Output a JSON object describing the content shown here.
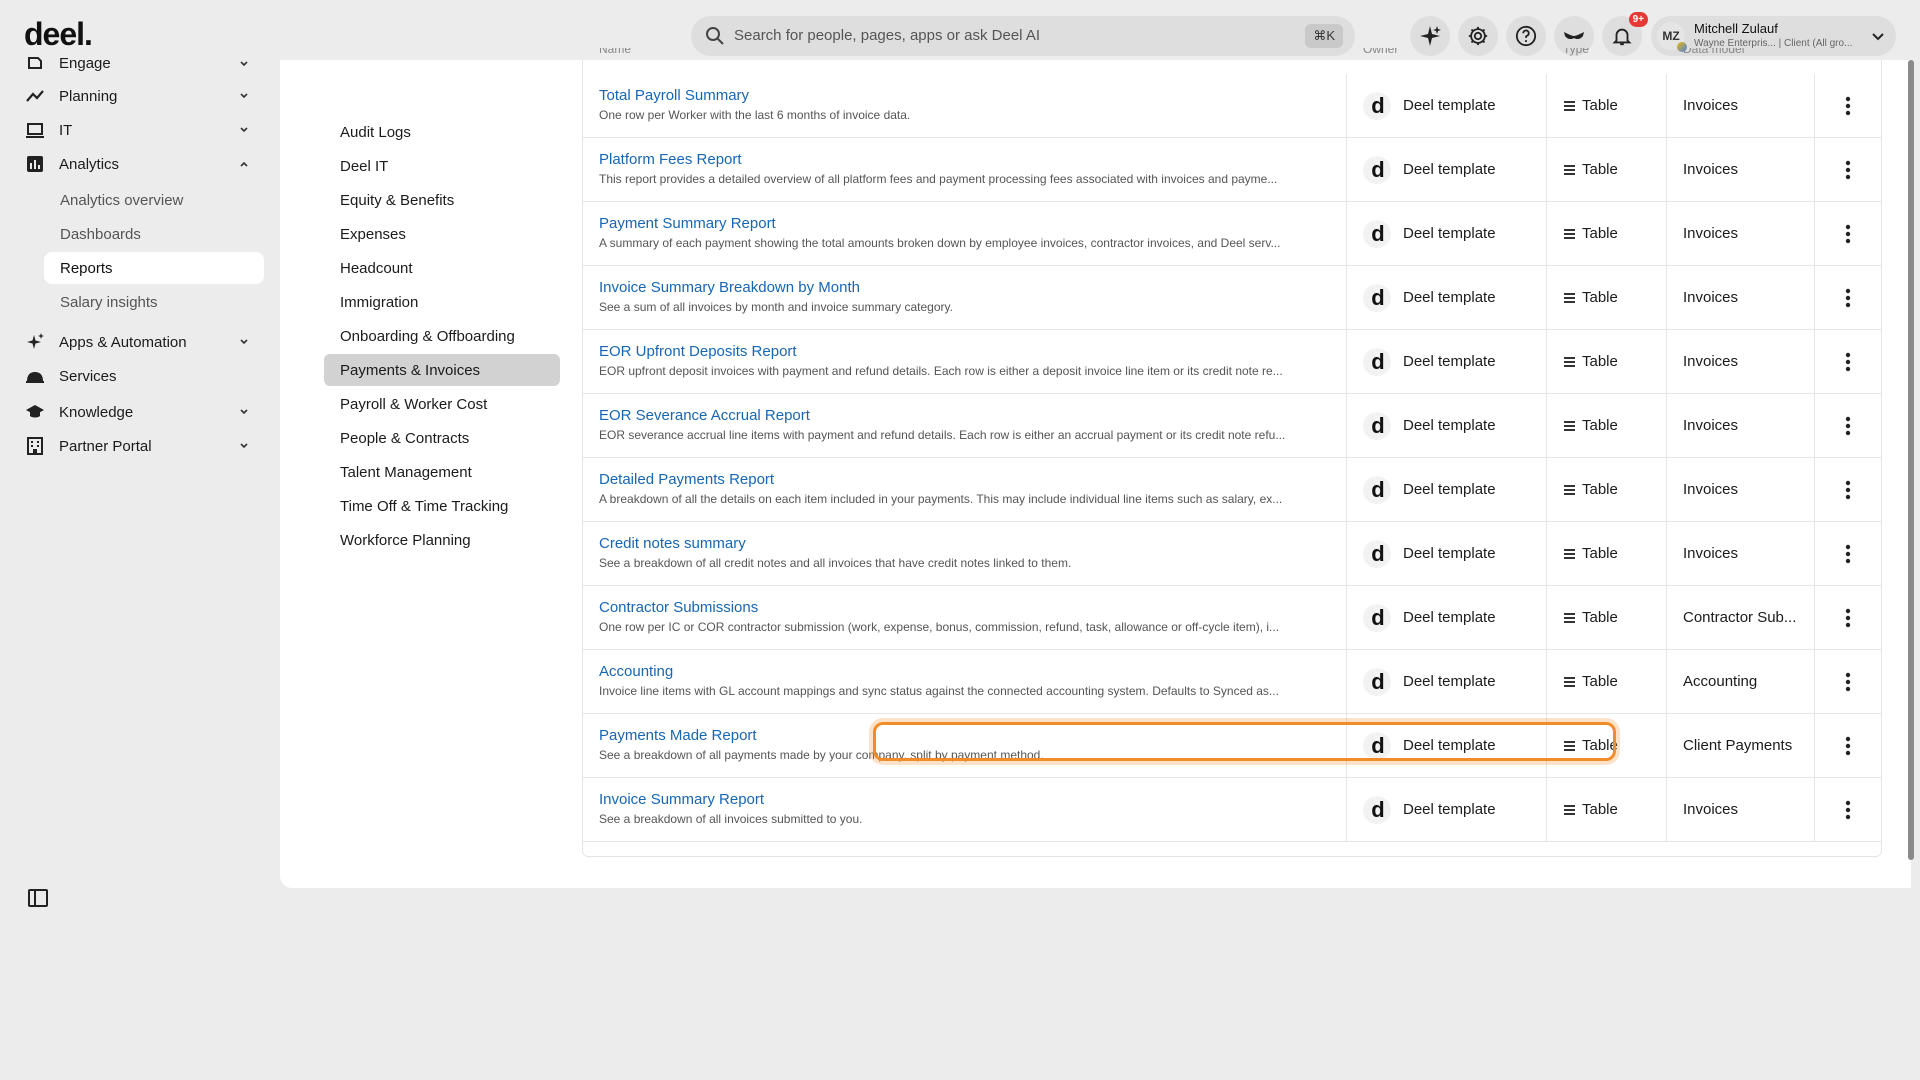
{
  "header": {
    "logo": "deel.",
    "search_placeholder": "Search for people, pages, apps or ask Deel AI",
    "search_shortcut": "⌘K",
    "notification_badge": "9+",
    "user": {
      "initials": "MZ",
      "name": "Mitchell Zulauf",
      "org": "Wayne Enterpris... | Client (All gro..."
    }
  },
  "sidebar": {
    "items": [
      {
        "label": "Engage",
        "icon": "engage-icon"
      },
      {
        "label": "Planning",
        "icon": "trend-icon"
      },
      {
        "label": "IT",
        "icon": "laptop-icon"
      },
      {
        "label": "Analytics",
        "icon": "bar-chart-icon"
      },
      {
        "label": "Apps & Automation",
        "icon": "sparkle-icon"
      },
      {
        "label": "Services",
        "icon": "bell-service-icon"
      },
      {
        "label": "Knowledge",
        "icon": "graduation-cap-icon"
      },
      {
        "label": "Partner Portal",
        "icon": "building-icon"
      }
    ],
    "analytics_sub": [
      {
        "label": "Analytics overview"
      },
      {
        "label": "Dashboards"
      },
      {
        "label": "Reports",
        "active": true
      },
      {
        "label": "Salary insights"
      }
    ]
  },
  "categories": [
    {
      "label": "Audit Logs"
    },
    {
      "label": "Deel IT"
    },
    {
      "label": "Equity & Benefits"
    },
    {
      "label": "Expenses"
    },
    {
      "label": "Headcount"
    },
    {
      "label": "Immigration"
    },
    {
      "label": "Onboarding & Offboarding"
    },
    {
      "label": "Payments & Invoices",
      "active": true
    },
    {
      "label": "Payroll & Worker Cost"
    },
    {
      "label": "People & Contracts"
    },
    {
      "label": "Talent Management"
    },
    {
      "label": "Time Off & Time Tracking"
    },
    {
      "label": "Workforce Planning"
    }
  ],
  "table": {
    "columns": [
      "Name",
      "Owner",
      "Type",
      "Data model"
    ],
    "rows": [
      {
        "title": "Total Payroll Summary",
        "desc": "One row per Worker with the last 6 months of invoice data.",
        "owner": "Deel template",
        "type": "Table",
        "model": "Invoices"
      },
      {
        "title": "Platform Fees Report",
        "desc": "This report provides a detailed overview of all platform fees and payment processing fees associated with invoices and payme...",
        "owner": "Deel template",
        "type": "Table",
        "model": "Invoices"
      },
      {
        "title": "Payment Summary Report",
        "desc": "A summary of each payment showing the total amounts broken down by employee invoices, contractor invoices, and Deel serv...",
        "owner": "Deel template",
        "type": "Table",
        "model": "Invoices"
      },
      {
        "title": "Invoice Summary Breakdown by Month",
        "desc": "See a sum of all invoices by month and invoice summary category.",
        "owner": "Deel template",
        "type": "Table",
        "model": "Invoices"
      },
      {
        "title": "EOR Upfront Deposits Report",
        "desc": "EOR upfront deposit invoices with payment and refund details. Each row is either a deposit invoice line item or its credit note re...",
        "owner": "Deel template",
        "type": "Table",
        "model": "Invoices"
      },
      {
        "title": "EOR Severance Accrual Report",
        "desc": "EOR severance accrual line items with payment and refund details. Each row is either an accrual payment or its credit note refu...",
        "owner": "Deel template",
        "type": "Table",
        "model": "Invoices"
      },
      {
        "title": "Detailed Payments Report",
        "desc": "A breakdown of all the details on each item included in your payments. This may include individual line items such as salary, ex...",
        "owner": "Deel template",
        "type": "Table",
        "model": "Invoices"
      },
      {
        "title": "Credit notes summary",
        "desc": "See a breakdown of all credit notes and all invoices that have credit notes linked to them.",
        "owner": "Deel template",
        "type": "Table",
        "model": "Invoices"
      },
      {
        "title": "Contractor Submissions",
        "desc": "One row per IC or COR contractor submission (work, expense, bonus, commission, refund, task, allowance or off-cycle item), i...",
        "owner": "Deel template",
        "type": "Table",
        "model": "Contractor Sub..."
      },
      {
        "title": "Accounting",
        "desc": "Invoice line items with GL account mappings and sync status against the connected accounting system. Defaults to Synced as...",
        "owner": "Deel template",
        "type": "Table",
        "model": "Accounting"
      },
      {
        "title": "Payments Made Report",
        "desc": "See a breakdown of all payments made by your company, split by payment method.",
        "owner": "Deel template",
        "type": "Table",
        "model": "Client Payments"
      },
      {
        "title": "Invoice Summary Report",
        "desc": "See a breakdown of all invoices submitted to you.",
        "owner": "Deel template",
        "type": "Table",
        "model": "Invoices"
      }
    ]
  },
  "colors": {
    "link": "#1766b5",
    "highlight": "#f28c28",
    "badge": "#e53935"
  }
}
